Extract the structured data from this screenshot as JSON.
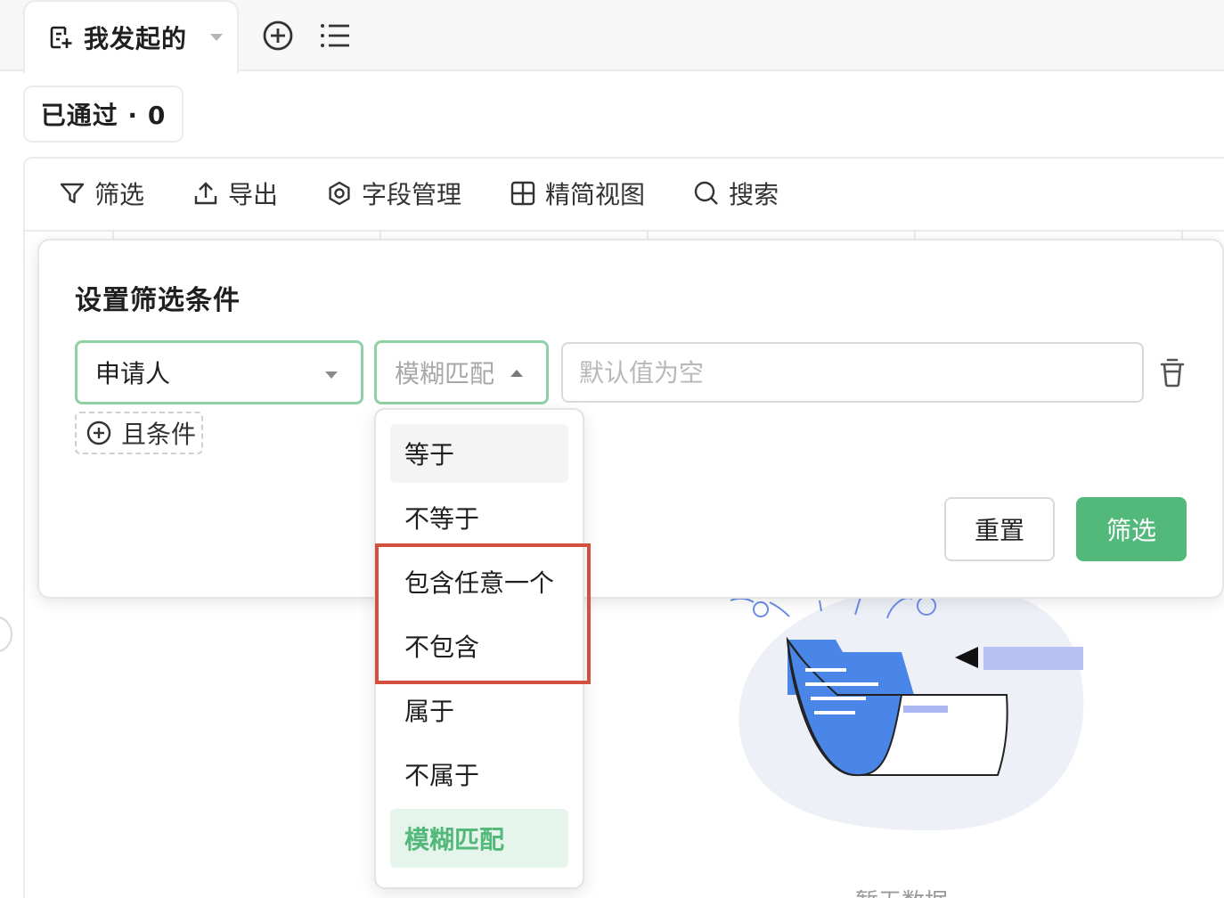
{
  "tabs": {
    "active_label": "我发起的"
  },
  "status_pill": {
    "label": "已通过 · 0"
  },
  "toolbar": {
    "items": [
      {
        "label": "筛选",
        "icon": "filter-icon"
      },
      {
        "label": "导出",
        "icon": "upload-icon"
      },
      {
        "label": "字段管理",
        "icon": "settings-icon"
      },
      {
        "label": "精简视图",
        "icon": "grid-icon"
      },
      {
        "label": "搜索",
        "icon": "search-icon"
      }
    ]
  },
  "filter_panel": {
    "title": "设置筛选条件",
    "field_value": "申请人",
    "operator_value": "模糊匹配",
    "value_placeholder": "默认值为空",
    "and_condition_label": "且条件",
    "reset_label": "重置",
    "submit_label": "筛选"
  },
  "operator_dropdown": {
    "options": [
      "等于",
      "不等于",
      "包含任意一个",
      "不包含",
      "属于",
      "不属于",
      "模糊匹配"
    ],
    "hovered": "等于",
    "selected": "模糊匹配"
  },
  "empty_state": {
    "text": "暂无数据"
  },
  "colors": {
    "brand_green": "#52b97a",
    "focus_border": "#8fd1a4",
    "highlight_red": "#d2503d"
  }
}
